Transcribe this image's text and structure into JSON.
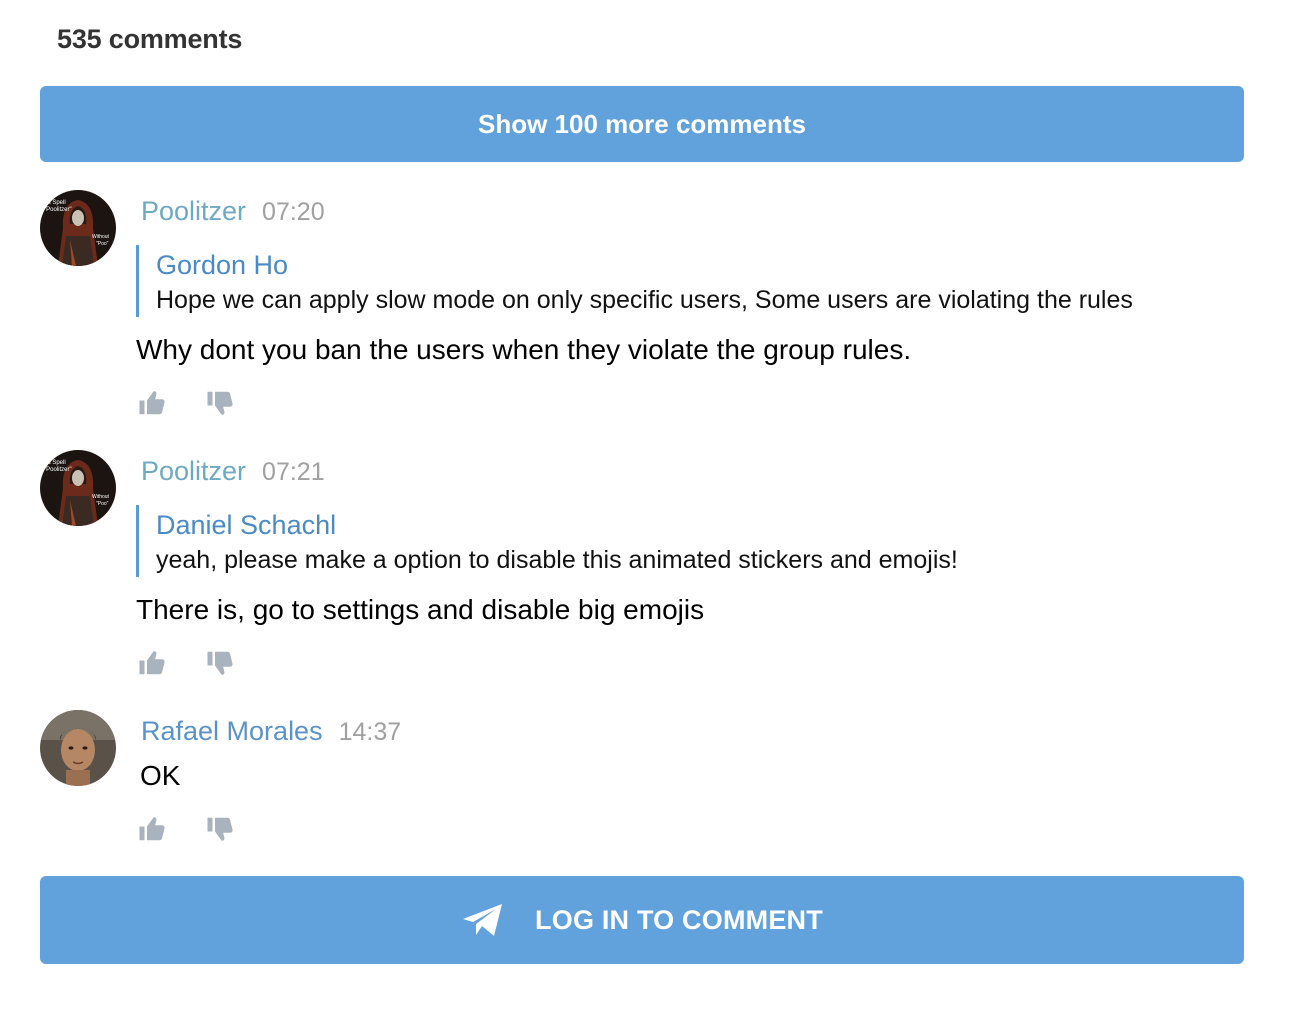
{
  "header": {
    "comment_count": "535 comments",
    "show_more_label": "Show 100 more comments"
  },
  "comments": [
    {
      "author": "Poolitzer",
      "time": "07:20",
      "avatar_icon": "hooded-figure-avatar",
      "reply_to": {
        "author": "Gordon Ho",
        "text": "Hope we can apply slow mode on only specific users, Some users are violating the rules"
      },
      "text": "Why dont you ban the users when they violate the group rules."
    },
    {
      "author": "Poolitzer",
      "time": "07:21",
      "avatar_icon": "hooded-figure-avatar",
      "reply_to": {
        "author": "Daniel Schachl",
        "text": "yeah, please make a option to disable this animated stickers and emojis!"
      },
      "text": "There is, go to settings and disable big emojis"
    },
    {
      "author": "Rafael Morales",
      "time": "14:37",
      "avatar_icon": "person-photo-avatar",
      "text": "OK"
    }
  ],
  "actions": {
    "like_icon": "thumbs-up-icon",
    "dislike_icon": "thumbs-down-icon"
  },
  "footer": {
    "login_label": "LOG IN TO COMMENT",
    "login_icon": "telegram-plane-icon"
  },
  "colors": {
    "button_bg": "#62a2dc",
    "author_teal": "#6fa9c0",
    "author_blue": "#5b93c8",
    "quote_bar": "#5b9bd5",
    "timestamp": "#a0a0a0",
    "action_icon": "#a8b3bd"
  }
}
